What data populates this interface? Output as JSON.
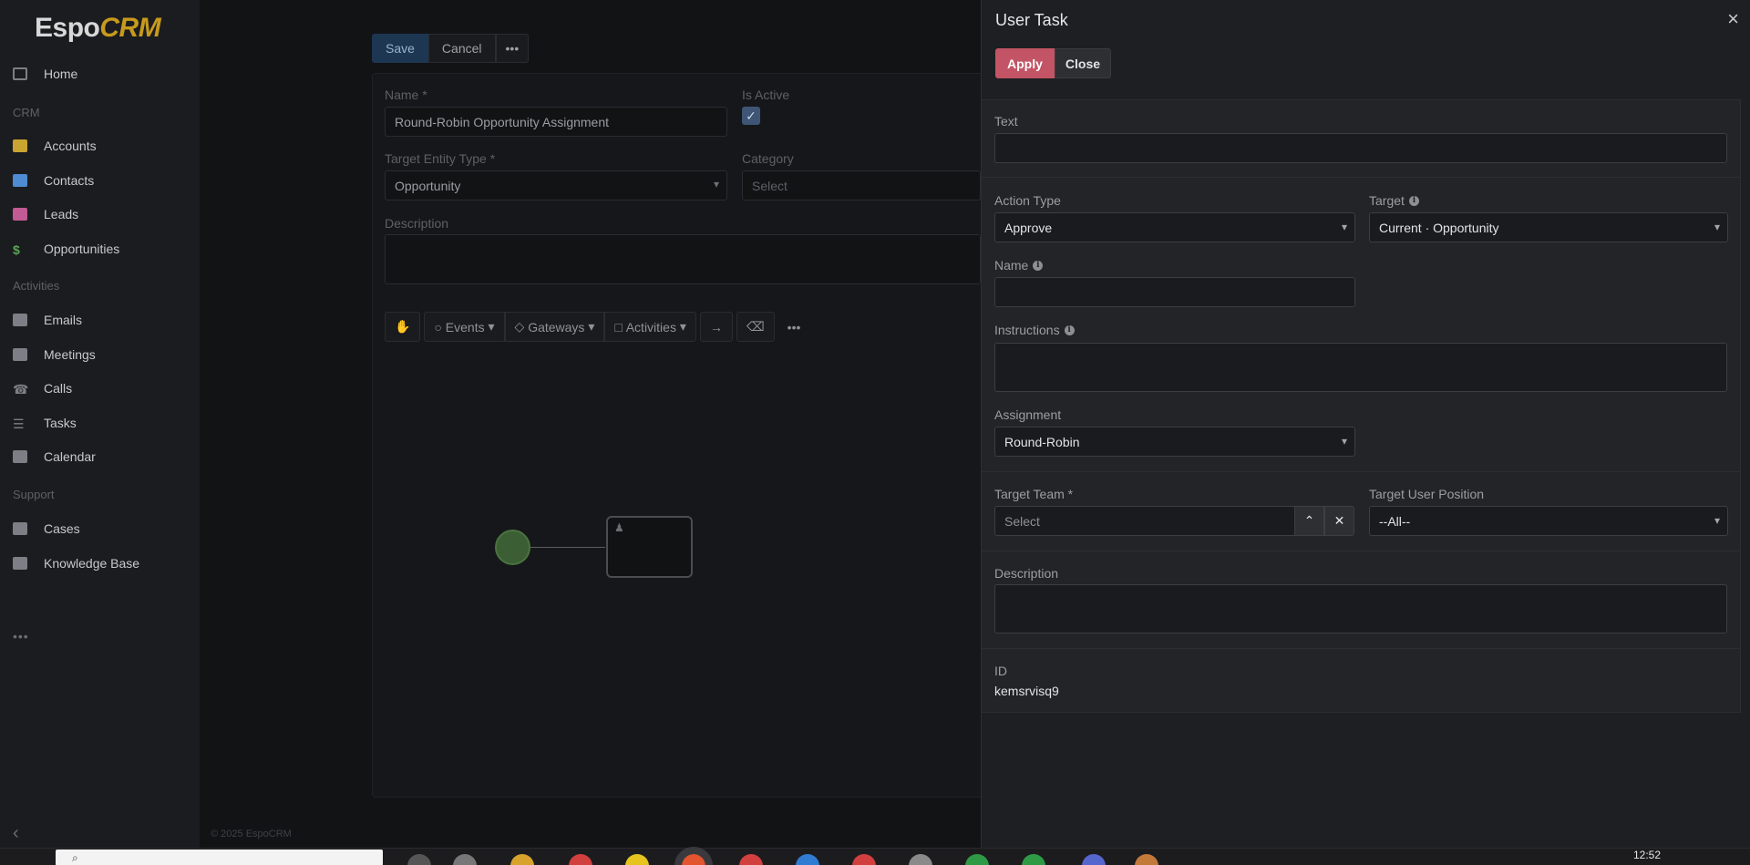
{
  "app": {
    "logo_text": "Espo",
    "logo_accent": "CRM"
  },
  "sidebar": {
    "items": [
      {
        "label": "Home",
        "icon": "grid-icon",
        "color": "#7c7f85"
      },
      {
        "section": "CRM"
      },
      {
        "label": "Accounts",
        "icon": "building-icon",
        "color": "#c9a431"
      },
      {
        "label": "Contacts",
        "icon": "contact-card-icon",
        "color": "#4e8bd1"
      },
      {
        "label": "Leads",
        "icon": "id-card-icon",
        "color": "#c25a93"
      },
      {
        "label": "Opportunities",
        "icon": "dollar-icon",
        "color": "#5aa556"
      },
      {
        "section": "Activities"
      },
      {
        "label": "Emails",
        "icon": "envelope-icon",
        "color": "#7c7f85"
      },
      {
        "label": "Meetings",
        "icon": "calendar-check-icon",
        "color": "#7c7f85"
      },
      {
        "label": "Calls",
        "icon": "phone-icon",
        "color": "#7c7f85"
      },
      {
        "label": "Tasks",
        "icon": "list-icon",
        "color": "#7c7f85"
      },
      {
        "label": "Calendar",
        "icon": "calendar-icon",
        "color": "#7c7f85"
      },
      {
        "section": "Support"
      },
      {
        "label": "Cases",
        "icon": "briefcase-icon",
        "color": "#7c7f85"
      },
      {
        "label": "Knowledge Base",
        "icon": "book-icon",
        "color": "#7c7f85"
      }
    ],
    "more": "•••",
    "collapse": "‹"
  },
  "main": {
    "toolbar": {
      "save": "Save",
      "cancel": "Cancel",
      "more": "•••"
    },
    "form": {
      "name_label": "Name *",
      "name_value": "Round-Robin Opportunity Assignment",
      "is_active_label": "Is Active",
      "target_entity_label": "Target Entity Type *",
      "target_entity_value": "Opportunity",
      "category_label": "Category",
      "category_placeholder": "Select",
      "description_label": "Description"
    },
    "diagram_toolbar": {
      "events": "Events",
      "gateways": "Gateways",
      "activities": "Activities"
    },
    "copyright": "© 2025 EspoCRM"
  },
  "modal": {
    "title": "User Task",
    "apply": "Apply",
    "close": "Close",
    "close_icon": "×",
    "fields": {
      "text_label": "Text",
      "text_value": "",
      "action_type_label": "Action Type",
      "action_type_value": "Approve",
      "target_label": "Target",
      "target_value": "Current · Opportunity",
      "name_label": "Name",
      "name_value": "",
      "instructions_label": "Instructions",
      "instructions_value": "",
      "assignment_label": "Assignment",
      "assignment_value": "Round-Robin",
      "target_team_label": "Target Team *",
      "target_team_placeholder": "Select",
      "target_user_position_label": "Target User Position",
      "target_user_position_value": "--All--",
      "description_label": "Description",
      "description_value": "",
      "id_label": "ID",
      "id_value": "kemsrvisq9"
    },
    "accent_color": "#c35465"
  },
  "taskbar": {
    "clock": "12:52"
  }
}
